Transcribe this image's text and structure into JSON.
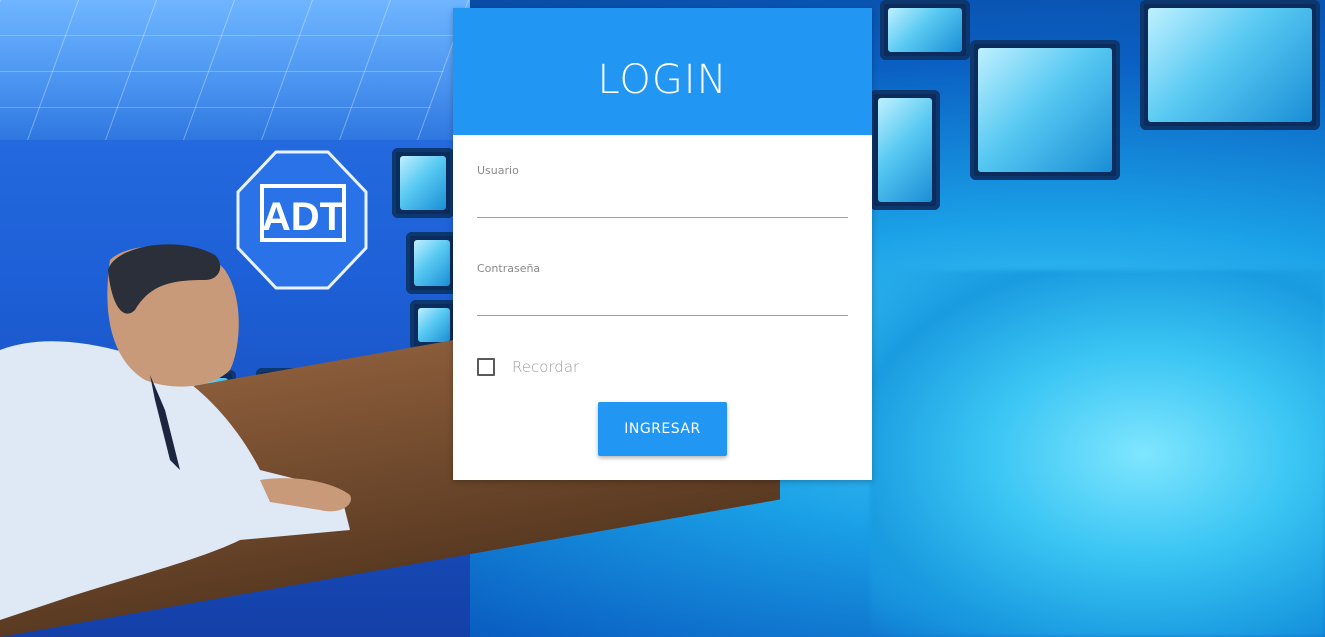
{
  "login": {
    "title": "LOGIN",
    "username": {
      "label": "Usuario",
      "value": ""
    },
    "password": {
      "label": "Contraseña",
      "value": ""
    },
    "remember": {
      "label": "Recordar",
      "checked": false
    },
    "submit_label": "INGRESAR"
  },
  "background": {
    "logo_text": "ADT",
    "colors": {
      "accent": "#2196f3",
      "card": "#ffffff"
    }
  }
}
